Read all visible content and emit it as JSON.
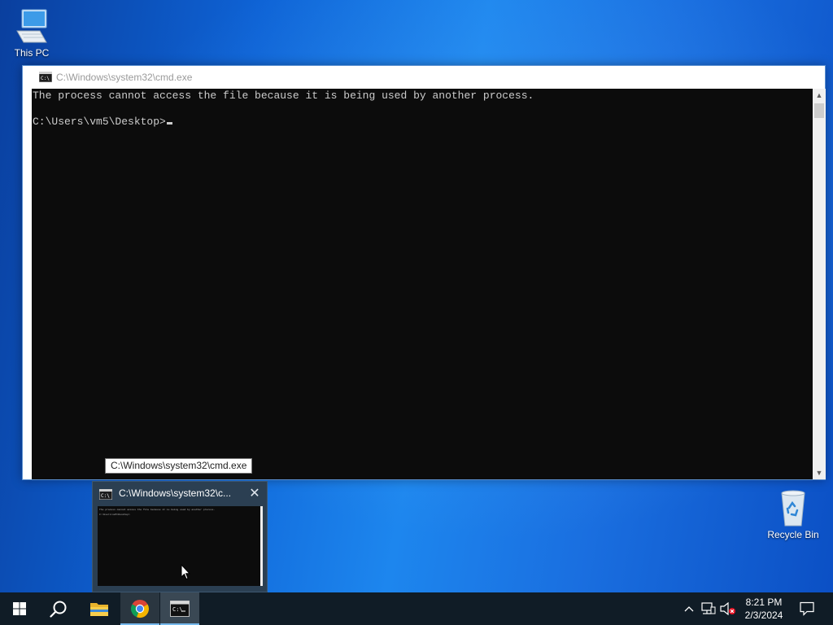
{
  "desktop": {
    "icons": [
      {
        "label": "This PC"
      },
      {
        "label": "Recycle Bin"
      }
    ]
  },
  "cmd_window": {
    "title": "C:\\Windows\\system32\\cmd.exe",
    "lines": [
      "The process cannot access the file because it is being used by another process.",
      "",
      "C:\\Users\\vm5\\Desktop>"
    ],
    "icon": "cmd-app-icon"
  },
  "tooltip": {
    "text": "C:\\Windows\\system32\\cmd.exe"
  },
  "thumbnail_preview": {
    "title": "C:\\Windows\\system32\\c...",
    "close_icon": "close-icon",
    "preview_lines": [
      "The process cannot access the file because it is being used by another process.",
      "C:\\Users\\vm5\\Desktop>"
    ]
  },
  "taskbar": {
    "items": [
      {
        "name": "start",
        "icon": "windows-logo-icon"
      },
      {
        "name": "search",
        "icon": "search-icon"
      },
      {
        "name": "file-explorer",
        "icon": "folder-icon"
      },
      {
        "name": "chrome",
        "icon": "chrome-icon"
      },
      {
        "name": "cmd",
        "icon": "cmd-icon",
        "active": true
      }
    ],
    "tray": {
      "clock_time": "8:21 PM",
      "clock_date": "2/3/2024"
    }
  },
  "colors": {
    "taskbar": "#101c26",
    "console_bg": "#0c0c0c",
    "console_fg": "#cccccc",
    "accent": "#76b9ed"
  }
}
